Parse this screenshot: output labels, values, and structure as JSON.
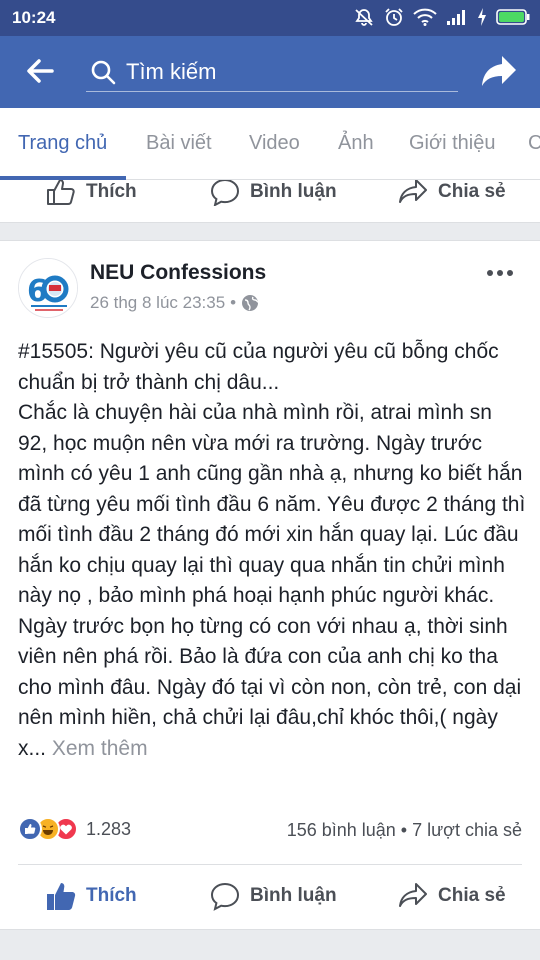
{
  "status_bar": {
    "time": "10:24"
  },
  "app_bar": {
    "search_placeholder": "Tìm kiếm"
  },
  "tabs": [
    {
      "label": "Trang chủ",
      "active": true
    },
    {
      "label": "Bài viết"
    },
    {
      "label": "Video"
    },
    {
      "label": "Ảnh"
    },
    {
      "label": "Giới thiệu"
    },
    {
      "label": "C"
    }
  ],
  "actions": {
    "like": "Thích",
    "comment": "Bình luận",
    "share": "Chia sẻ"
  },
  "post": {
    "page_name": "NEU Confessions",
    "timestamp": "26 thg 8 lúc 23:35",
    "dot": "•",
    "text": "#15505: Người yêu cũ của người yêu cũ bỗng chốc chuẩn bị trở thành chị dâu...\nChắc là chuyện hài của nhà mình rồi, atrai mình sn 92, học muộn nên vừa mới ra trường. Ngày trước mình có yêu 1 anh cũng gần nhà ạ, nhưng ko biết hắn đã từng yêu mối tình đầu 6 năm. Yêu được 2 tháng thì mối tình đầu 2 tháng đó mới xin hắn quay lại. Lúc đầu hắn ko chịu quay lại thì quay qua nhắn tin chửi mình này nọ , bảo mình phá hoại hạnh phúc người khác. Ngày trước bọn họ từng có con với nhau ạ, thời sinh viên nên phá rồi. Bảo là đứa con của anh chị ko tha cho mình đâu. Ngày đó tại vì còn non, còn trẻ, con dại nên mình hiền, chả chửi lại đâu,chỉ khóc thôi,( ngày x...",
    "see_more": "Xem thêm",
    "reaction_count": "1.283",
    "comments_shares": "156 bình luận • 7 lượt chia sẻ"
  },
  "colors": {
    "brand_blue": "#4267b2",
    "status_bar": "#354c8c",
    "secondary_text": "#90949c"
  }
}
